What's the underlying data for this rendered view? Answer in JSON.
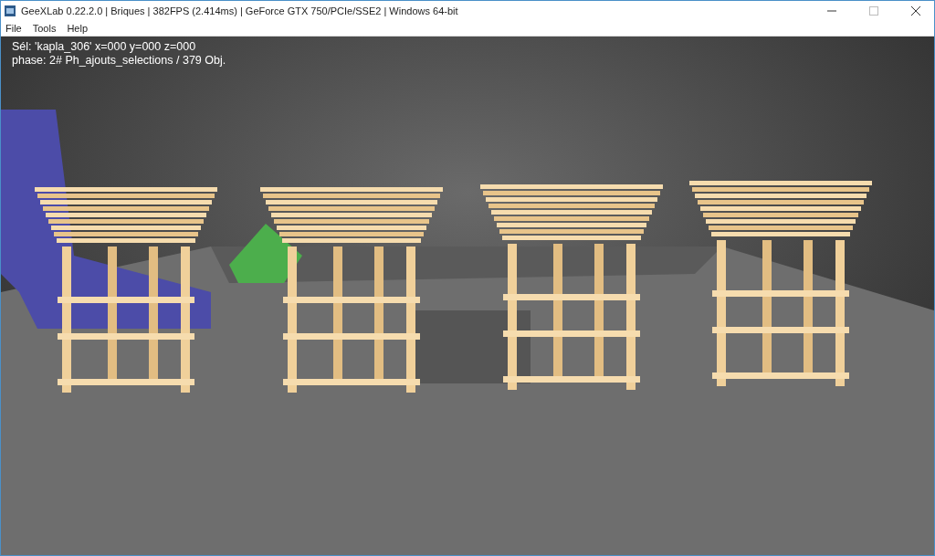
{
  "window": {
    "title": "GeeXLab 0.22.2.0 | Briques | 382FPS (2.414ms) | GeForce GTX 750/PCIe/SSE2 | Windows 64-bit"
  },
  "menu": [
    {
      "label": "File"
    },
    {
      "label": "Tools"
    },
    {
      "label": "Help"
    }
  ],
  "viewport": {
    "overlay_lines": [
      "Sél:  'kapla_306' x=000 y=000 z=000",
      "phase:  2# Ph_ajouts_selections / 379 Obj."
    ]
  }
}
